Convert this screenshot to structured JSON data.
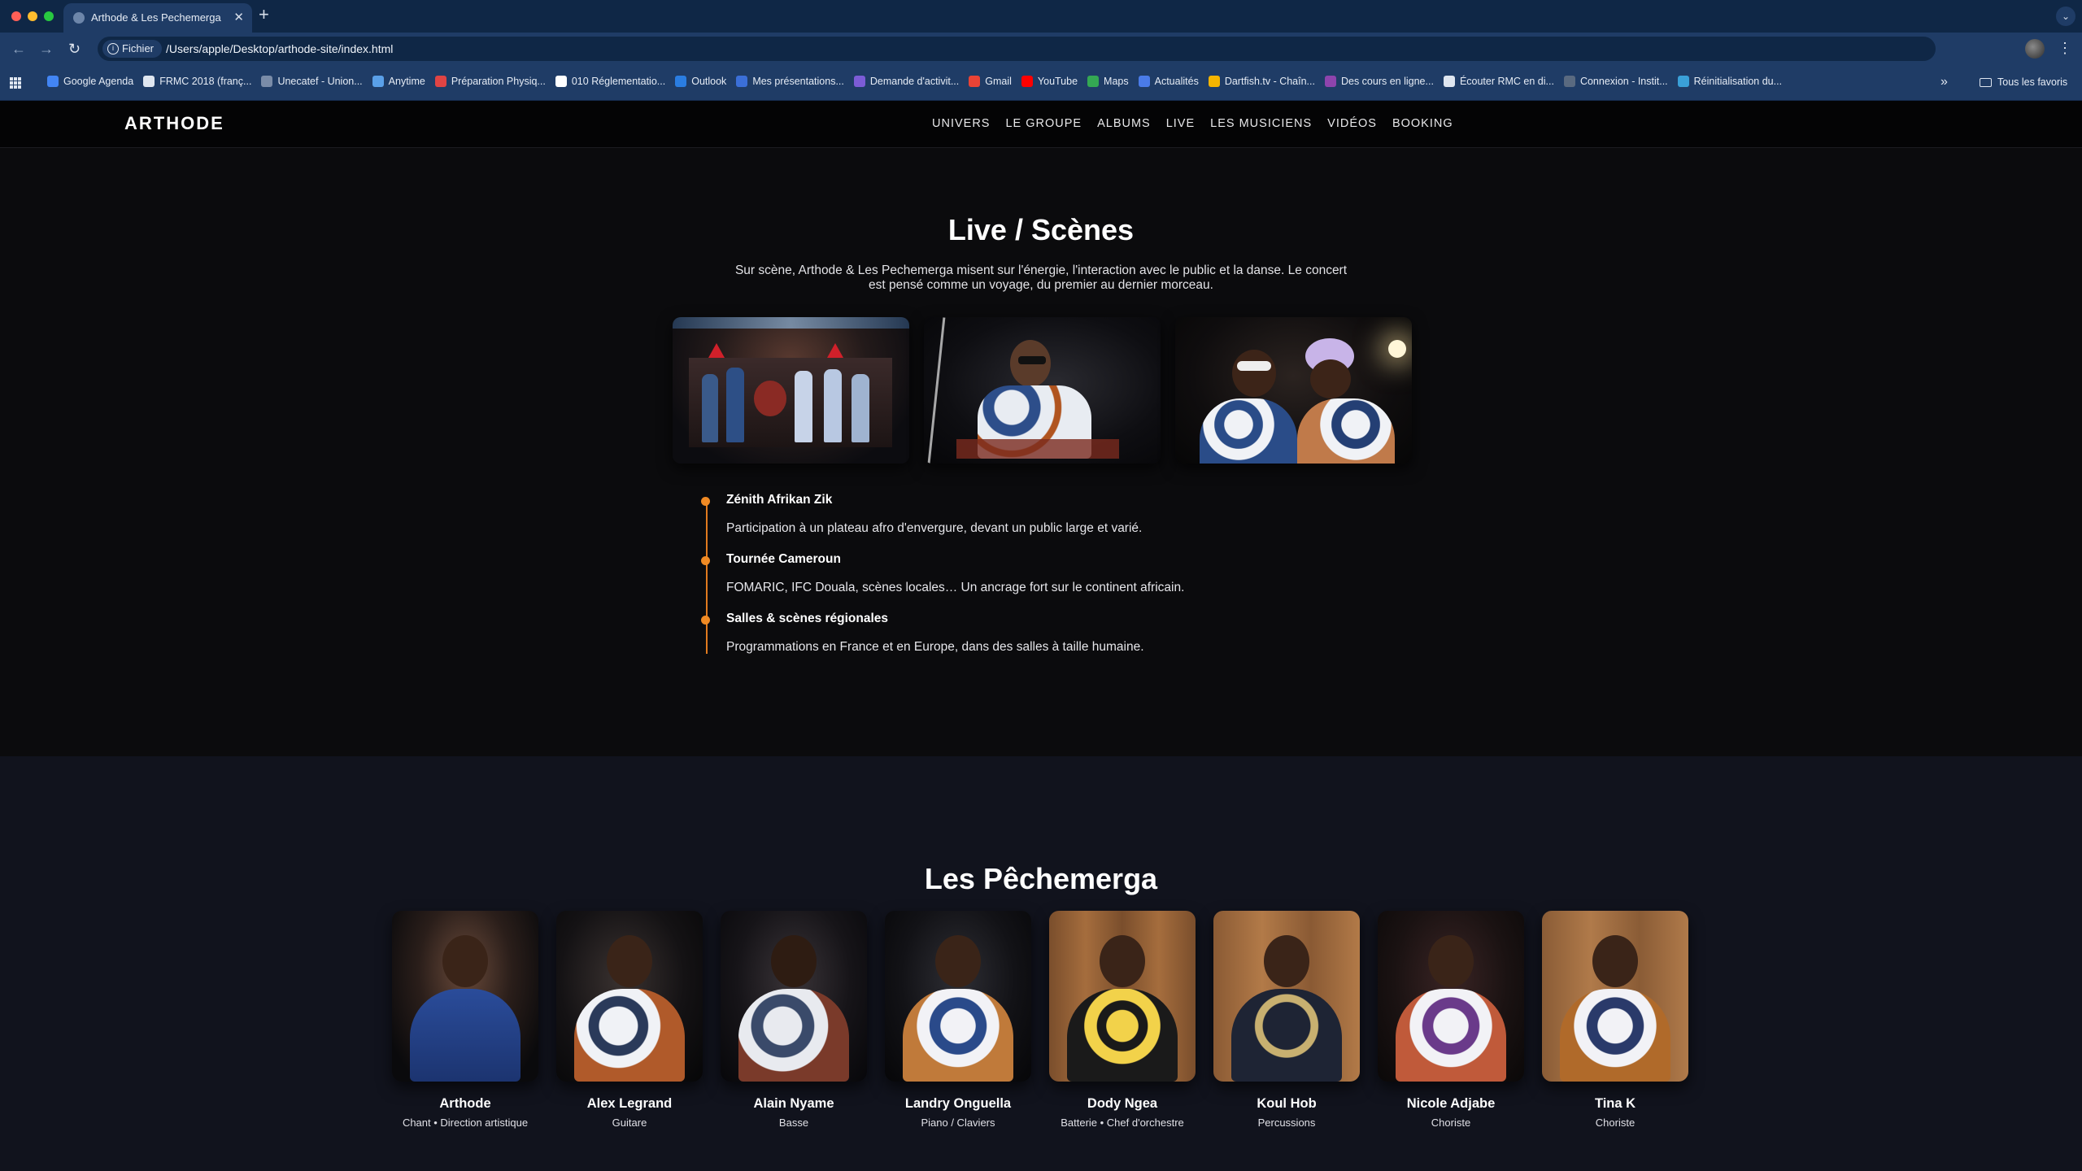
{
  "browser": {
    "tab_title": "Arthode & Les Pechemerga",
    "site_chip": "Fichier",
    "url": "/Users/apple/Desktop/arthode-site/index.html",
    "bookmarks": [
      {
        "label": "Google Agenda",
        "color": "#4285f4"
      },
      {
        "label": "FRMC 2018 (franç...",
        "color": "#dfe6f0"
      },
      {
        "label": "Unecatef - Union...",
        "color": "#7a8ca8"
      },
      {
        "label": "Anytime",
        "color": "#5aa0e8"
      },
      {
        "label": "Préparation Physiq...",
        "color": "#e04444"
      },
      {
        "label": "010 Réglementatio...",
        "color": "#ffffff"
      },
      {
        "label": "Outlook",
        "color": "#2a7de1"
      },
      {
        "label": "Mes présentations...",
        "color": "#3b6fd8"
      },
      {
        "label": "Demande d'activit...",
        "color": "#7c5cd6"
      },
      {
        "label": "Gmail",
        "color": "#ea4335"
      },
      {
        "label": "YouTube",
        "color": "#ff0000"
      },
      {
        "label": "Maps",
        "color": "#34a853"
      },
      {
        "label": "Actualités",
        "color": "#4a7be8"
      },
      {
        "label": "Dartfish.tv - Chaîn...",
        "color": "#f4b400"
      },
      {
        "label": "Des cours en ligne...",
        "color": "#8e44ad"
      },
      {
        "label": "Écouter RMC en di...",
        "color": "#dfe6f0"
      },
      {
        "label": "Connexion - Instit...",
        "color": "#5a6a80"
      },
      {
        "label": "Réinitialisation du...",
        "color": "#3aa0d8"
      }
    ],
    "all_bookmarks": "Tous les favoris"
  },
  "site": {
    "brand": "ARTHODE",
    "nav": [
      "UNIVERS",
      "LE GROUPE",
      "ALBUMS",
      "LIVE",
      "LES MUSICIENS",
      "VIDÉOS",
      "BOOKING"
    ]
  },
  "live": {
    "title": "Live / Scènes",
    "intro": "Sur scène, Arthode & Les Pechemerga misent sur l'énergie, l'interaction avec le public et la danse. Le concert est pensé comme un voyage, du premier au dernier morceau.",
    "timeline": [
      {
        "title": "Zénith Afrikan Zik",
        "desc": "Participation à un plateau afro d'envergure, devant un public large et varié."
      },
      {
        "title": "Tournée Cameroun",
        "desc": "FOMARIC, IFC Douala, scènes locales… Un ancrage fort sur le continent africain."
      },
      {
        "title": "Salles & scènes régionales",
        "desc": "Programmations en France et en Europe, dans des salles à taille humaine."
      }
    ]
  },
  "band": {
    "title": "Les Pêchemerga",
    "members": [
      {
        "name": "Arthode",
        "role": "Chant • Direction artistique"
      },
      {
        "name": "Alex Legrand",
        "role": "Guitare"
      },
      {
        "name": "Alain Nyame",
        "role": "Basse"
      },
      {
        "name": "Landry Onguella",
        "role": "Piano / Claviers"
      },
      {
        "name": "Dody Ngea",
        "role": "Batterie • Chef d'orchestre"
      },
      {
        "name": "Koul Hob",
        "role": "Percussions"
      },
      {
        "name": "Nicole Adjabe",
        "role": "Choriste"
      },
      {
        "name": "Tina K",
        "role": "Choriste"
      }
    ]
  }
}
